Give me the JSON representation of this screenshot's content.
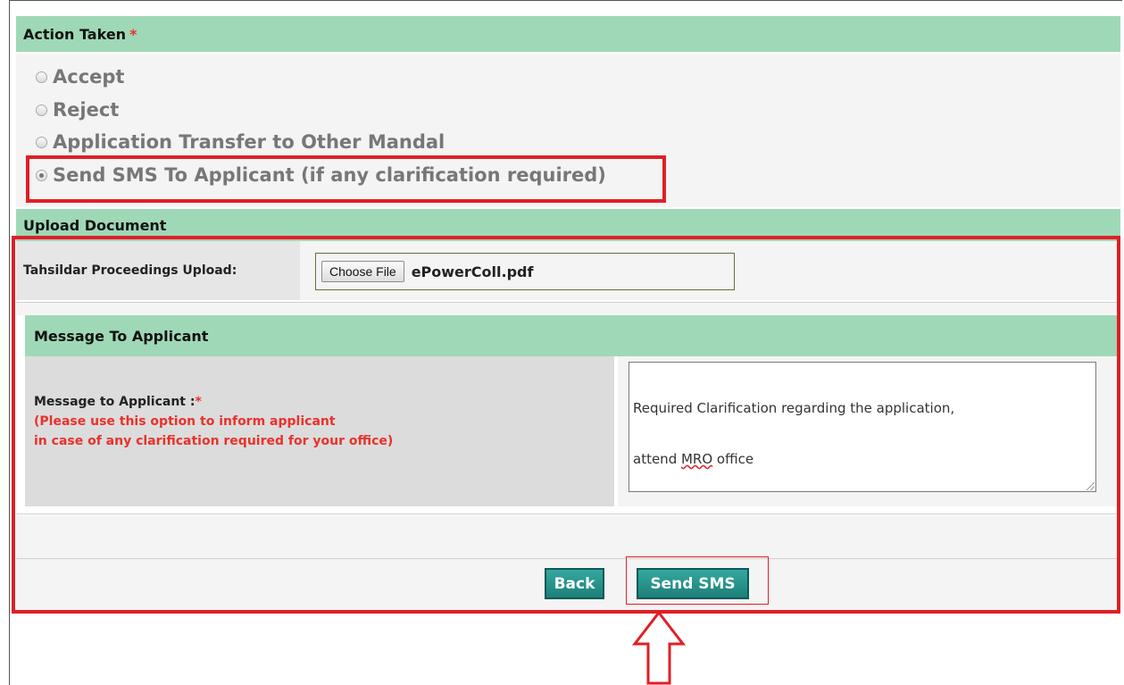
{
  "action_section": {
    "title": "Action Taken",
    "required_marker": "*",
    "options": [
      {
        "label": "Accept",
        "checked": false
      },
      {
        "label": "Reject",
        "checked": false
      },
      {
        "label": "Application Transfer to Other Mandal",
        "checked": false
      },
      {
        "label": "Send SMS To Applicant (if any clarification required)",
        "checked": true
      }
    ]
  },
  "upload_section": {
    "title": "Upload Document",
    "field_label": "Tahsildar Proceedings Upload:",
    "choose_button": "Choose File",
    "file_name": "ePowerColl.pdf"
  },
  "message_section": {
    "title": "Message To Applicant",
    "label": "Message to Applicant :",
    "required_marker": "*",
    "hint_line1": "(Please use this option to inform applicant",
    "hint_line2": "in case of any clarification required for your office)",
    "textarea_line1": "Required Clarification regarding the application,",
    "textarea_line2_pre": "attend ",
    "textarea_line2_spell": "MRO",
    "textarea_line2_post": " office"
  },
  "buttons": {
    "back": "Back",
    "send_sms": "Send SMS"
  },
  "colors": {
    "header_green": "#9fd8b7",
    "highlight_red": "#e01f26",
    "button_teal": "#1d7f78",
    "hint_red": "#e8322b"
  }
}
